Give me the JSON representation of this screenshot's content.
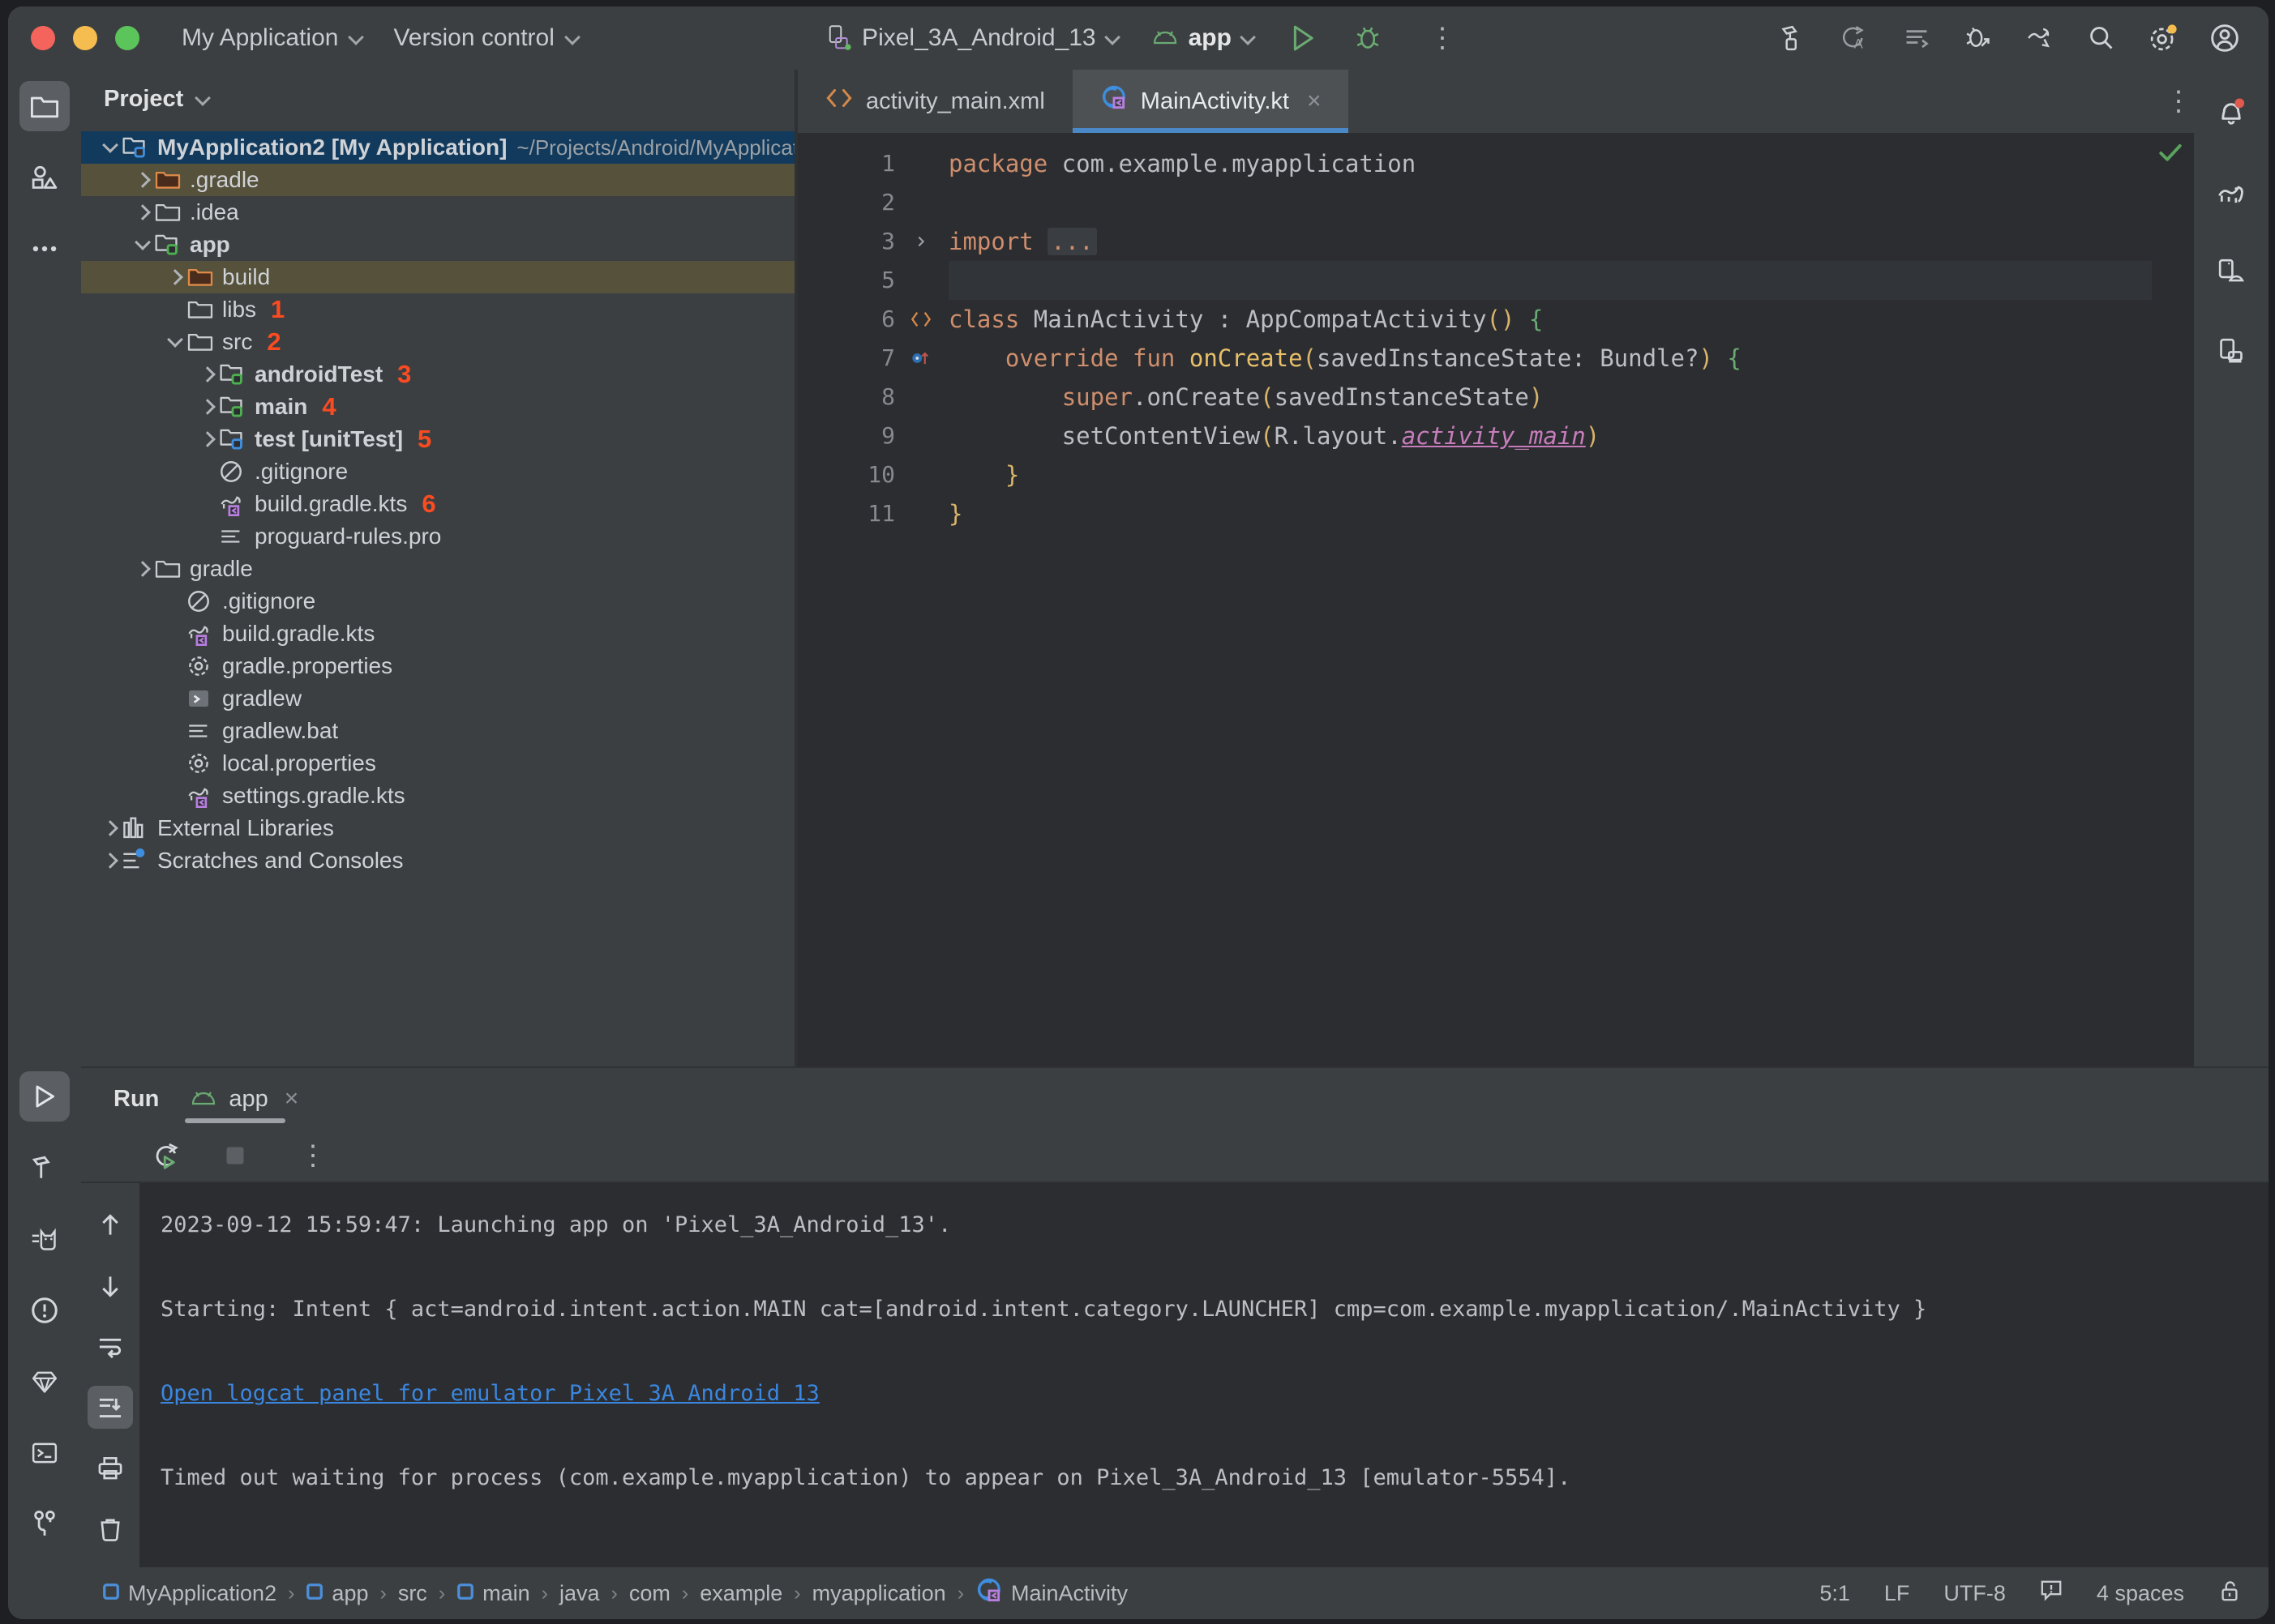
{
  "titlebar": {
    "menus": [
      {
        "label": "My Application",
        "icon": "chevron-down-icon"
      },
      {
        "label": "Version control",
        "icon": "chevron-down-icon"
      }
    ],
    "device_selector": {
      "label": "Pixel_3A_Android_13",
      "icon": "device-icon"
    },
    "run_config": {
      "label": "app",
      "icon": "android-head-icon"
    },
    "actions": [
      {
        "name": "run-button",
        "icon": "play-icon",
        "color": "#6aab73"
      },
      {
        "name": "debug-button",
        "icon": "bug-icon",
        "color": "#6aab73"
      },
      {
        "name": "more-actions-button",
        "icon": "kebab-icon"
      }
    ],
    "right_icons": [
      "build-hammer-icon",
      "code-with-me-icon",
      "inspection-list-icon",
      "debug-attach-icon",
      "gradle-sync-icon",
      "search-icon",
      "settings-gear-icon",
      "account-avatar-icon"
    ],
    "settings_badge_color": "#f5bd4f"
  },
  "left_rail": {
    "top": [
      {
        "name": "sidebar-item-project",
        "icon": "folder-icon",
        "active": true
      },
      {
        "name": "sidebar-item-resource-manager",
        "icon": "shapes-icon",
        "active": false
      },
      {
        "name": "sidebar-item-more-tools",
        "icon": "ellipsis-icon",
        "active": false
      }
    ],
    "bottom": [
      {
        "name": "sidebar-item-run",
        "icon": "play-icon",
        "active": true
      },
      {
        "name": "sidebar-item-build",
        "icon": "hammer-icon",
        "active": false
      },
      {
        "name": "sidebar-item-logcat",
        "icon": "cat-icon",
        "active": false
      },
      {
        "name": "sidebar-item-problems",
        "icon": "warning-circle-icon",
        "active": false
      },
      {
        "name": "sidebar-item-app-quality",
        "icon": "diamond-icon",
        "active": false
      },
      {
        "name": "sidebar-item-terminal",
        "icon": "terminal-icon",
        "active": false
      },
      {
        "name": "sidebar-item-version-control",
        "icon": "branch-icon",
        "active": false
      }
    ]
  },
  "right_rail": {
    "icons": [
      {
        "name": "notifications-button",
        "icon": "bell-icon",
        "badge": true,
        "badge_color": "#e05a50"
      },
      {
        "name": "gradle-tool-button",
        "icon": "gradle-elephant-icon"
      },
      {
        "name": "device-manager-button",
        "icon": "device-manager-icon"
      },
      {
        "name": "running-devices-button",
        "icon": "running-devices-icon"
      }
    ]
  },
  "project_panel": {
    "title": "Project",
    "tree": [
      {
        "indent": 0,
        "arrow": "down",
        "icon": "module-folder-blue-icon",
        "label": "MyApplication2 [My Application]",
        "bold": true,
        "path": "~/Projects/Android/MyApplicat",
        "selected": true,
        "excluded": false,
        "annot": ""
      },
      {
        "indent": 1,
        "arrow": "right",
        "icon": "folder-orange-icon",
        "label": ".gradle",
        "bold": false,
        "path": "",
        "selected": false,
        "excluded": true,
        "annot": ""
      },
      {
        "indent": 1,
        "arrow": "right",
        "icon": "folder-icon",
        "label": ".idea",
        "bold": false,
        "path": "",
        "selected": false,
        "excluded": false,
        "annot": ""
      },
      {
        "indent": 1,
        "arrow": "down",
        "icon": "module-folder-green-icon",
        "label": "app",
        "bold": true,
        "path": "",
        "selected": false,
        "excluded": false,
        "annot": ""
      },
      {
        "indent": 2,
        "arrow": "right",
        "icon": "folder-orange-icon",
        "label": "build",
        "bold": false,
        "path": "",
        "selected": false,
        "excluded": true,
        "annot": ""
      },
      {
        "indent": 2,
        "arrow": "none",
        "icon": "folder-icon",
        "label": "libs",
        "bold": false,
        "path": "",
        "selected": false,
        "excluded": false,
        "annot": "1"
      },
      {
        "indent": 2,
        "arrow": "down",
        "icon": "folder-icon",
        "label": "src",
        "bold": false,
        "path": "",
        "selected": false,
        "excluded": false,
        "annot": "2"
      },
      {
        "indent": 3,
        "arrow": "right",
        "icon": "module-folder-green-icon",
        "label": "androidTest",
        "bold": true,
        "path": "",
        "selected": false,
        "excluded": false,
        "annot": "3"
      },
      {
        "indent": 3,
        "arrow": "right",
        "icon": "module-folder-green-icon",
        "label": "main",
        "bold": true,
        "path": "",
        "selected": false,
        "excluded": false,
        "annot": "4"
      },
      {
        "indent": 3,
        "arrow": "right",
        "icon": "module-folder-blue-icon",
        "label": "test [unitTest]",
        "bold": true,
        "path": "",
        "selected": false,
        "excluded": false,
        "annot": "5"
      },
      {
        "indent": 3,
        "arrow": "none",
        "icon": "gitignore-icon",
        "label": ".gitignore",
        "bold": false,
        "path": "",
        "selected": false,
        "excluded": false,
        "annot": ""
      },
      {
        "indent": 3,
        "arrow": "none",
        "icon": "gradle-kts-icon",
        "label": "build.gradle.kts",
        "bold": false,
        "path": "",
        "selected": false,
        "excluded": false,
        "annot": "6"
      },
      {
        "indent": 3,
        "arrow": "none",
        "icon": "text-file-icon",
        "label": "proguard-rules.pro",
        "bold": false,
        "path": "",
        "selected": false,
        "excluded": false,
        "annot": ""
      },
      {
        "indent": 1,
        "arrow": "right",
        "icon": "folder-icon",
        "label": "gradle",
        "bold": false,
        "path": "",
        "selected": false,
        "excluded": false,
        "annot": ""
      },
      {
        "indent": 2,
        "arrow": "none",
        "icon": "gitignore-icon",
        "label": ".gitignore",
        "bold": false,
        "path": "",
        "selected": false,
        "excluded": false,
        "annot": ""
      },
      {
        "indent": 2,
        "arrow": "none",
        "icon": "gradle-kts-icon",
        "label": "build.gradle.kts",
        "bold": false,
        "path": "",
        "selected": false,
        "excluded": false,
        "annot": ""
      },
      {
        "indent": 2,
        "arrow": "none",
        "icon": "properties-icon",
        "label": "gradle.properties",
        "bold": false,
        "path": "",
        "selected": false,
        "excluded": false,
        "annot": ""
      },
      {
        "indent": 2,
        "arrow": "none",
        "icon": "shell-script-icon",
        "label": "gradlew",
        "bold": false,
        "path": "",
        "selected": false,
        "excluded": false,
        "annot": ""
      },
      {
        "indent": 2,
        "arrow": "none",
        "icon": "text-file-icon",
        "label": "gradlew.bat",
        "bold": false,
        "path": "",
        "selected": false,
        "excluded": false,
        "annot": ""
      },
      {
        "indent": 2,
        "arrow": "none",
        "icon": "properties-icon",
        "label": "local.properties",
        "bold": false,
        "path": "",
        "selected": false,
        "excluded": false,
        "annot": ""
      },
      {
        "indent": 2,
        "arrow": "none",
        "icon": "gradle-kts-icon",
        "label": "settings.gradle.kts",
        "bold": false,
        "path": "",
        "selected": false,
        "excluded": false,
        "annot": ""
      },
      {
        "indent": 0,
        "arrow": "right",
        "icon": "libraries-icon",
        "label": "External Libraries",
        "bold": false,
        "path": "",
        "selected": false,
        "excluded": false,
        "annot": ""
      },
      {
        "indent": 0,
        "arrow": "right",
        "icon": "scratches-icon",
        "label": "Scratches and Consoles",
        "bold": false,
        "path": "",
        "selected": false,
        "excluded": false,
        "annot": ""
      }
    ]
  },
  "editor": {
    "tabs": [
      {
        "label": "activity_main.xml",
        "icon": "xml-file-icon",
        "active": false,
        "closable": false
      },
      {
        "label": "MainActivity.kt",
        "icon": "kotlin-class-icon",
        "active": true,
        "closable": true
      }
    ],
    "tab_close_glyph": "×",
    "options_glyph": "⋮",
    "inspection_status": "ok",
    "lines": [
      {
        "num": "1",
        "gutter_icon": "",
        "caret": false,
        "text": "package com.example.myapplication"
      },
      {
        "num": "2",
        "gutter_icon": "",
        "caret": false,
        "text": ""
      },
      {
        "num": "3",
        "gutter_icon": "fold-arrow",
        "caret": false,
        "text": "import ..."
      },
      {
        "num": "5",
        "gutter_icon": "",
        "caret": true,
        "text": ""
      },
      {
        "num": "6",
        "gutter_icon": "class-mark",
        "caret": false,
        "text": "class MainActivity : AppCompatActivity() {"
      },
      {
        "num": "7",
        "gutter_icon": "override-mark",
        "caret": false,
        "text": "    override fun onCreate(savedInstanceState: Bundle?) {"
      },
      {
        "num": "8",
        "gutter_icon": "",
        "caret": false,
        "text": "        super.onCreate(savedInstanceState)"
      },
      {
        "num": "9",
        "gutter_icon": "",
        "caret": false,
        "text": "        setContentView(R.layout.activity_main)"
      },
      {
        "num": "10",
        "gutter_icon": "",
        "caret": false,
        "text": "    }"
      },
      {
        "num": "11",
        "gutter_icon": "",
        "caret": false,
        "text": "}"
      }
    ]
  },
  "run_panel": {
    "title": "Run",
    "tab": {
      "label": "app",
      "icon": "android-head-icon",
      "close_glyph": "×"
    },
    "toolbar": [
      {
        "name": "rerun-button",
        "icon": "rerun-icon"
      },
      {
        "name": "stop-button",
        "icon": "stop-icon"
      },
      {
        "name": "more-options-button",
        "icon": "kebab-icon"
      }
    ],
    "console_rail": [
      {
        "name": "scroll-up-button",
        "icon": "arrow-up-icon",
        "active": false
      },
      {
        "name": "scroll-down-button",
        "icon": "arrow-down-icon",
        "active": false
      },
      {
        "name": "soft-wrap-button",
        "icon": "soft-wrap-icon",
        "active": false
      },
      {
        "name": "scroll-to-end-button",
        "icon": "scroll-to-end-icon",
        "active": true
      },
      {
        "name": "print-button",
        "icon": "printer-icon",
        "active": false
      },
      {
        "name": "clear-all-button",
        "icon": "trash-icon",
        "active": false
      }
    ],
    "console": [
      {
        "type": "text",
        "text": "2023-09-12 15:59:47: Launching app on 'Pixel_3A_Android_13'."
      },
      {
        "type": "gap",
        "text": ""
      },
      {
        "type": "text",
        "text": "Starting: Intent { act=android.intent.action.MAIN cat=[android.intent.category.LAUNCHER] cmp=com.example.myapplication/.MainActivity }"
      },
      {
        "type": "gap",
        "text": ""
      },
      {
        "type": "link",
        "text": "Open logcat panel for emulator Pixel 3A Android 13"
      },
      {
        "type": "gap",
        "text": ""
      },
      {
        "type": "text",
        "text": "Timed out waiting for process (com.example.myapplication) to appear on Pixel_3A_Android_13 [emulator-5554]."
      }
    ]
  },
  "status_bar": {
    "breadcrumbs": [
      {
        "label": "MyApplication2",
        "icon": "module-square-icon"
      },
      {
        "label": "app",
        "icon": "module-square-icon"
      },
      {
        "label": "src",
        "icon": ""
      },
      {
        "label": "main",
        "icon": "module-square-icon"
      },
      {
        "label": "java",
        "icon": ""
      },
      {
        "label": "com",
        "icon": ""
      },
      {
        "label": "example",
        "icon": ""
      },
      {
        "label": "myapplication",
        "icon": ""
      },
      {
        "label": "MainActivity",
        "icon": "kotlin-class-icon"
      }
    ],
    "separator": "›",
    "right": {
      "caret_position": "5:1",
      "line_separator": "LF",
      "encoding": "UTF-8",
      "indent": "4 spaces",
      "inspection_icon": "inspection-badge-icon",
      "lock_icon": "unlocked-icon"
    }
  }
}
